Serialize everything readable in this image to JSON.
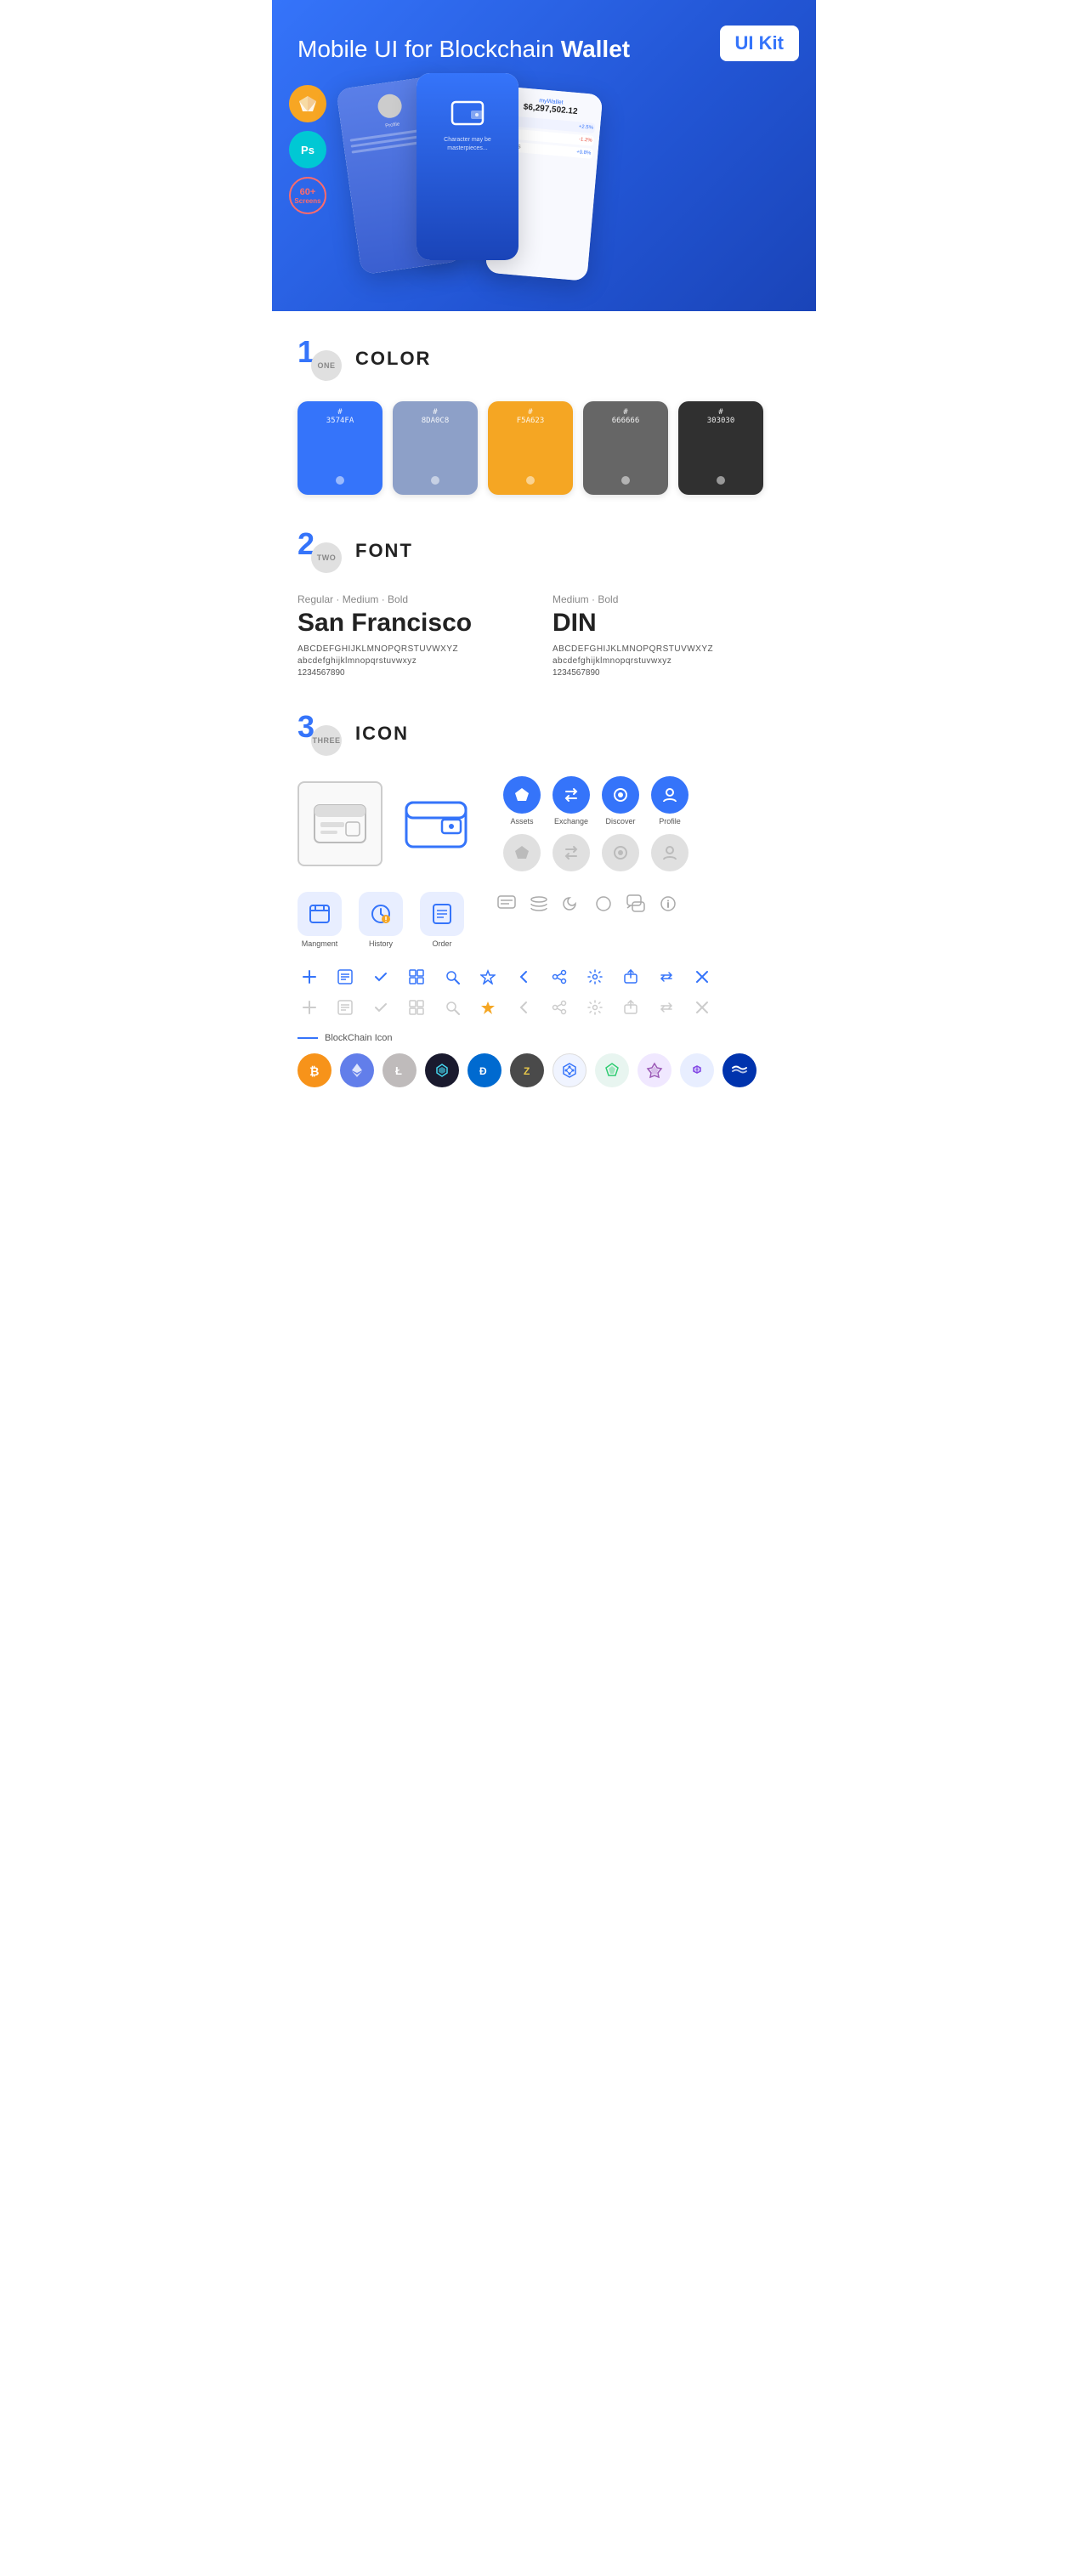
{
  "hero": {
    "title_regular": "Mobile UI for Blockchain ",
    "title_bold": "Wallet",
    "badge": "UI Kit",
    "badges": [
      {
        "name": "Sketch",
        "symbol": "✦",
        "bg": "#f7a623"
      },
      {
        "name": "Photoshop",
        "symbol": "Ps",
        "bg": "#00c8d4"
      },
      {
        "name": "Screens",
        "line1": "60+",
        "line2": "Screens",
        "border": "#ff6b6b"
      }
    ]
  },
  "sections": {
    "color": {
      "number": "1",
      "number_label": "ONE",
      "title": "COLOR",
      "swatches": [
        {
          "hex": "#3574FA",
          "code": "#\n3574FA"
        },
        {
          "hex": "#8D A0C8",
          "code": "#\n8DA0C8"
        },
        {
          "hex": "#F5A623",
          "code": "#\nF5A623"
        },
        {
          "hex": "#666666",
          "code": "#\n666666"
        },
        {
          "hex": "#303030",
          "code": "#\n303030"
        }
      ]
    },
    "font": {
      "number": "2",
      "number_label": "TWO",
      "title": "FONT",
      "fonts": [
        {
          "style_label": "Regular · Medium · Bold",
          "name": "San Francisco",
          "uppercase": "ABCDEFGHIJKLMNOPQRSTUVWXYZ",
          "lowercase": "abcdefghijklmnopqrstuvwxyz",
          "numbers": "1234567890",
          "class": "sf"
        },
        {
          "style_label": "Medium · Bold",
          "name": "DIN",
          "uppercase": "ABCDEFGHIJKLMNOPQRSTUVWXYZ",
          "lowercase": "abcdefghijklmnopqrstuvwxyz",
          "numbers": "1234567890",
          "class": "din"
        }
      ]
    },
    "icon": {
      "number": "3",
      "number_label": "THREE",
      "title": "ICON",
      "nav_icons": [
        {
          "label": "Assets",
          "symbol": "◆",
          "color": "#3574FA"
        },
        {
          "label": "Exchange",
          "symbol": "⇄",
          "color": "#3574FA"
        },
        {
          "label": "Discover",
          "symbol": "●",
          "color": "#3574FA"
        },
        {
          "label": "Profile",
          "symbol": "◗",
          "color": "#3574FA"
        }
      ],
      "nav_icons_gray": [
        {
          "symbol": "◆"
        },
        {
          "symbol": "⇄"
        },
        {
          "symbol": "●"
        },
        {
          "symbol": "◗"
        }
      ],
      "app_icons": [
        {
          "label": "Mangment",
          "symbol": "▣",
          "bg": "#e8eeff",
          "color": "#3574FA"
        },
        {
          "label": "History",
          "symbol": "◷",
          "bg": "#e8eeff",
          "color": "#3574FA"
        },
        {
          "label": "Order",
          "symbol": "≡",
          "bg": "#e8eeff",
          "color": "#3574FA"
        }
      ],
      "misc_icons": [
        "💬",
        "≡",
        "◑",
        "●",
        "💬",
        "ℹ"
      ],
      "small_icons_blue": [
        "+",
        "⊞",
        "✓",
        "⊞",
        "🔍",
        "☆",
        "‹",
        "≪",
        "⚙",
        "⊡",
        "⇌",
        "✕"
      ],
      "small_icons_gray": [
        "+",
        "⊞",
        "✓",
        "⊞",
        "🔍",
        "☆",
        "‹",
        "≪",
        "⚙",
        "⊡",
        "⇌",
        "✕"
      ],
      "blockchain_label": "BlockChain Icon",
      "crypto_icons": [
        {
          "symbol": "₿",
          "bg": "#f7931a",
          "color": "#fff"
        },
        {
          "symbol": "Ξ",
          "bg": "#627eea",
          "color": "#fff"
        },
        {
          "symbol": "Ł",
          "bg": "#b8b8b8",
          "color": "#fff"
        },
        {
          "symbol": "◈",
          "bg": "#1a1a2e",
          "color": "#44d7f0"
        },
        {
          "symbol": "Đ",
          "bg": "#006ad0",
          "color": "#fff"
        },
        {
          "symbol": "Ƶ",
          "bg": "#444",
          "color": "#fff"
        },
        {
          "symbol": "⬡",
          "bg": "#f0f4ff",
          "color": "#3574FA"
        },
        {
          "symbol": "▲",
          "bg": "#e8f5f0",
          "color": "#2ecc71"
        },
        {
          "symbol": "◆",
          "bg": "#f0e8ff",
          "color": "#9b59b6"
        },
        {
          "symbol": "◈",
          "bg": "#e8f0ff",
          "color": "#3574FA"
        },
        {
          "symbol": "~",
          "bg": "#0033ad",
          "color": "#fff"
        }
      ]
    }
  }
}
